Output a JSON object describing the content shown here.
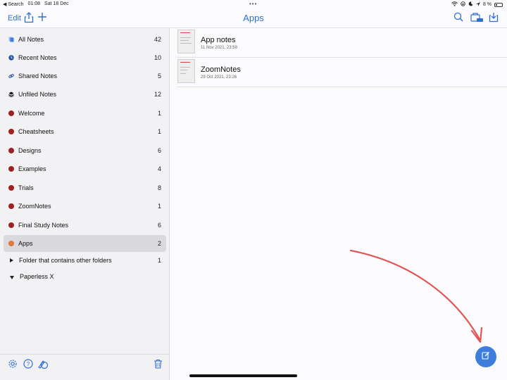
{
  "status_bar": {
    "back_label": "◀ Search",
    "time": "01:08",
    "date": "Sat 18 Dec",
    "battery": "8 %"
  },
  "toolbar": {
    "edit_label": "Edit",
    "title": "Apps"
  },
  "sidebar": {
    "items": [
      {
        "label": "All Notes",
        "count": "42",
        "icon": "notes-stack-icon",
        "color": "#3d7ddc"
      },
      {
        "label": "Recent Notes",
        "count": "10",
        "icon": "clock-icon",
        "color": "#1f4fa8"
      },
      {
        "label": "Shared Notes",
        "count": "5",
        "icon": "link-icon",
        "color": "#1f4fa8"
      },
      {
        "label": "Unfiled Notes",
        "count": "12",
        "icon": "layers-icon",
        "color": "#111111"
      },
      {
        "label": "Welcome",
        "count": "1",
        "icon": "folder-dot-icon",
        "color": "#9e2020"
      },
      {
        "label": "Cheatsheets",
        "count": "1",
        "icon": "folder-dot-icon",
        "color": "#9e2020"
      },
      {
        "label": "Designs",
        "count": "6",
        "icon": "folder-dot-icon",
        "color": "#9e2020"
      },
      {
        "label": "Examples",
        "count": "4",
        "icon": "folder-dot-icon",
        "color": "#9e2020"
      },
      {
        "label": "Trials",
        "count": "8",
        "icon": "folder-dot-icon",
        "color": "#9e2020"
      },
      {
        "label": "ZoomNotes",
        "count": "1",
        "icon": "folder-dot-icon",
        "color": "#9e2020"
      },
      {
        "label": "Final Study Notes",
        "count": "6",
        "icon": "folder-dot-icon",
        "color": "#9e2020"
      },
      {
        "label": "Apps",
        "count": "2",
        "icon": "folder-dot-icon",
        "color": "#e07a3a",
        "selected": true
      },
      {
        "label": "Folder that contains other folders",
        "count": "1",
        "icon": "disclosure-right-icon"
      },
      {
        "label": "Paperless X",
        "count": "",
        "icon": "disclosure-down-icon"
      }
    ]
  },
  "notes": [
    {
      "title": "App notes",
      "date": "11 Nov 2021, 23:58"
    },
    {
      "title": "ZoomNotes",
      "date": "29 Oct 2021, 23:26"
    }
  ],
  "colors": {
    "accent": "#2f6fd4",
    "fab": "#3d7ddc",
    "annotation_arrow": "#e05555"
  }
}
